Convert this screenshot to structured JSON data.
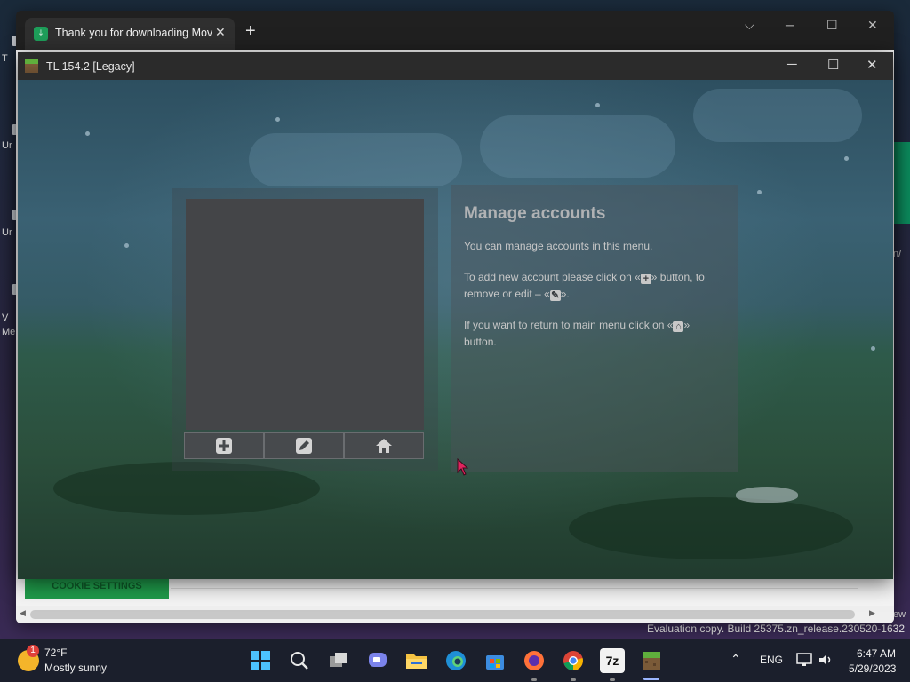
{
  "desktop": {
    "icon_labels": [
      "Ur",
      "T",
      "Ur",
      "V",
      "Me"
    ],
    "right_text": [
      "ew",
      "n/"
    ]
  },
  "evaluation": "Evaluation copy. Build 25375.zn_release.230520-1632",
  "browser": {
    "tab_title": "Thank you for downloading Mov",
    "new_tab_glyph": "+",
    "close_glyph": "✕",
    "cookie_button": "COOKIE SETTINGS"
  },
  "launcher": {
    "title": "TL 154.2 [Legacy]",
    "controls": {
      "minimize": "─",
      "maximize": "☐",
      "close": "✕"
    },
    "panel": {
      "heading": "Manage accounts",
      "p1": "You can manage accounts in this menu.",
      "p2_before": "To add new account please click on «",
      "p2_mid": "» button, to remove or edit – «",
      "p2_after": "».",
      "p3_before": "If you want to return to main menu click on «",
      "p3_after": "» button."
    },
    "buttons": [
      "add-account",
      "edit-account",
      "home"
    ]
  },
  "taskbar": {
    "weather_temp": "72°F",
    "weather_condition": "Mostly sunny",
    "weather_badge": "1",
    "apps": [
      {
        "name": "start",
        "color": "#3aa0ff"
      },
      {
        "name": "search",
        "color": "#e0e0e0"
      },
      {
        "name": "task-view",
        "color": "#cfcfcf"
      },
      {
        "name": "chat",
        "color": "#7b83eb"
      },
      {
        "name": "file-explorer",
        "color": "#f5c242"
      },
      {
        "name": "edge",
        "color": "#2ea7e0"
      },
      {
        "name": "store",
        "color": "#4a90e2"
      },
      {
        "name": "firefox",
        "color": "#ff7139"
      },
      {
        "name": "chrome",
        "color": "#34a853"
      },
      {
        "name": "7zip",
        "color": "#f0f0f0"
      },
      {
        "name": "minecraft-launcher",
        "color": "#5fae3c"
      }
    ],
    "sevenzip_label": "7z",
    "tray_chevron": "⌃",
    "language": "ENG",
    "time": "6:47 AM",
    "date": "5/29/2023"
  }
}
